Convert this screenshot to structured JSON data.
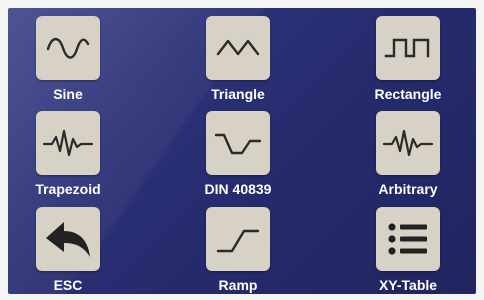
{
  "buttons": [
    {
      "label": "Sine",
      "icon": "sine-wave-icon"
    },
    {
      "label": "Triangle",
      "icon": "triangle-wave-icon"
    },
    {
      "label": "Rectangle",
      "icon": "rectangle-wave-icon"
    },
    {
      "label": "Trapezoid",
      "icon": "arbitrary-wave-icon"
    },
    {
      "label": "DIN 40839",
      "icon": "din-40839-curve-icon"
    },
    {
      "label": "Arbitrary",
      "icon": "arbitrary-wave-icon"
    },
    {
      "label": "ESC",
      "icon": "back-arrow-icon"
    },
    {
      "label": "Ramp",
      "icon": "ramp-icon"
    },
    {
      "label": "XY-Table",
      "icon": "list-icon"
    }
  ],
  "colors": {
    "background": "#2c3278",
    "tile": "#d8d1c5",
    "icon_stroke": "#2b2b2b",
    "label": "#ffffff"
  }
}
